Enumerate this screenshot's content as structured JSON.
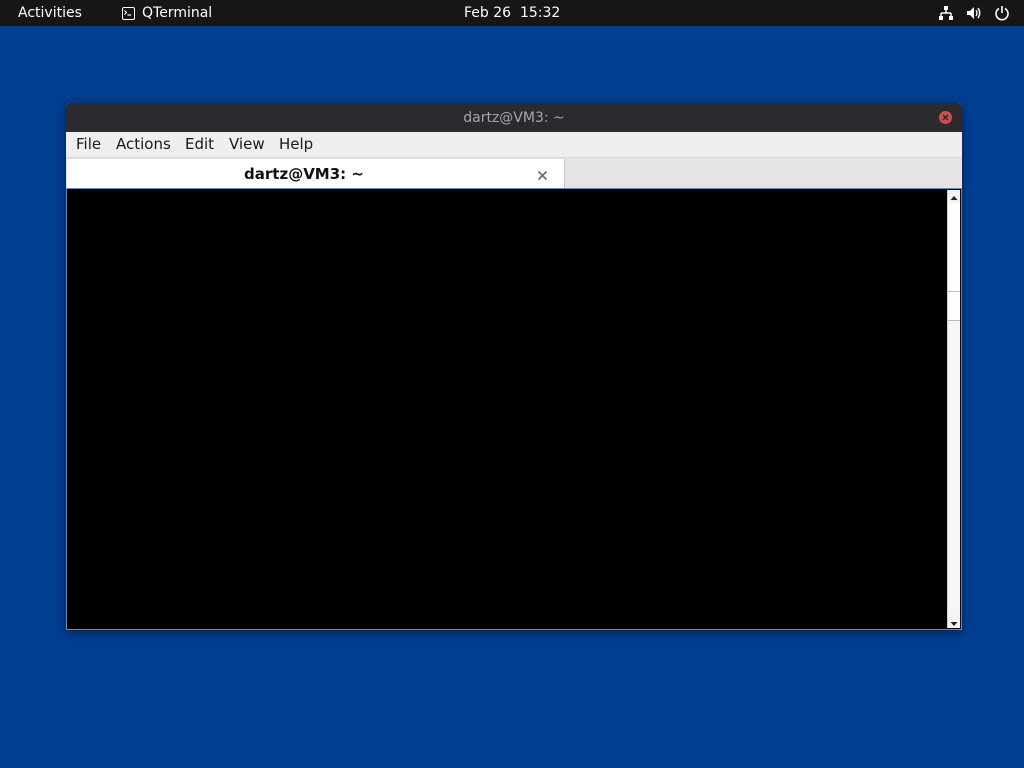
{
  "topbar": {
    "activities_label": "Activities",
    "app_name": "QTerminal",
    "app_icon": "terminal-icon",
    "clock": "Feb 26  15:32",
    "tray_icons": [
      "network-icon",
      "volume-icon",
      "power-icon"
    ]
  },
  "window": {
    "title": "dartz@VM3: ~",
    "close_icon": "close-icon",
    "menu": {
      "file": "File",
      "actions": "Actions",
      "edit": "Edit",
      "view": "View",
      "help": "Help"
    },
    "tabs": [
      {
        "label": "dartz@VM3: ~",
        "active": true
      }
    ]
  },
  "colors": {
    "desktop_background": "#003e92",
    "topbar_background": "#161616",
    "titlebar_background": "#2b2b2f",
    "close_button": "#c9504f",
    "terminal_background": "#000000",
    "terminal_border": "#5a8fc2"
  }
}
